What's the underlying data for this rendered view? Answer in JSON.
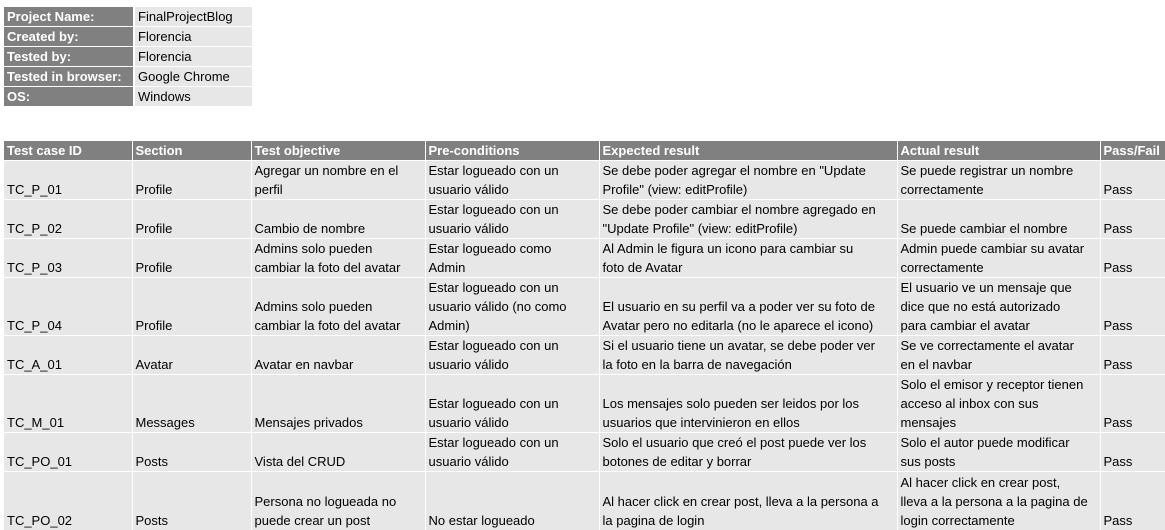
{
  "project_info": [
    {
      "key": "Project Name:",
      "value": "FinalProjectBlog"
    },
    {
      "key": "Created by:",
      "value": "Florencia"
    },
    {
      "key": "Tested by:",
      "value": "Florencia"
    },
    {
      "key": "Tested in browser:",
      "value": "Google Chrome"
    },
    {
      "key": "OS:",
      "value": "Windows"
    }
  ],
  "table": {
    "headers": [
      "Test case ID",
      "Section",
      "Test objective",
      "Pre-conditions",
      "Expected result",
      "Actual result",
      "Pass/Fail"
    ],
    "rows": [
      [
        "TC_P_01",
        "Profile",
        "Agregar un nombre en el\nperfil",
        "Estar logueado con un\nusuario válido",
        "Se debe poder agregar el nombre en \"Update\nProfile\" (view: editProfile)",
        "Se puede registrar un nombre\ncorrectamente",
        "Pass"
      ],
      [
        "TC_P_02",
        "Profile",
        "Cambio de nombre",
        "Estar logueado con un\nusuario válido",
        "Se debe poder cambiar el nombre agregado en\n\"Update Profile\" (view: editProfile)",
        "Se puede cambiar el nombre",
        "Pass"
      ],
      [
        "TC_P_03",
        "Profile",
        "Admins solo pueden\ncambiar la foto del avatar",
        "Estar logueado como\nAdmin",
        "Al Admin le figura un icono para cambiar su\nfoto de Avatar",
        "Admin puede cambiar su avatar\ncorrectamente",
        "Pass"
      ],
      [
        "TC_P_04",
        "Profile",
        "Admins solo pueden\ncambiar la foto del avatar",
        "Estar logueado con un\nusuario válido (no como\nAdmin)",
        "El usuario en su perfil va a poder ver su foto de\nAvatar pero no editarla (no le aparece el icono)",
        "El usuario ve un mensaje que\ndice que no está autorizado\npara cambiar el avatar",
        "Pass"
      ],
      [
        "TC_A_01",
        "Avatar",
        "Avatar en navbar",
        "Estar logueado con un\nusuario válido",
        "Si el usuario tiene un avatar, se debe poder ver\nla foto en la barra de navegación",
        "Se ve correctamente el avatar\nen el navbar",
        "Pass"
      ],
      [
        "TC_M_01",
        "Messages",
        "Mensajes privados",
        "Estar logueado con un\nusuario válido",
        "Los mensajes solo pueden ser leidos por los\nusuarios que intervinieron en ellos",
        "Solo el emisor y receptor tienen\nacceso al inbox con sus\nmensajes",
        "Pass"
      ],
      [
        "TC_PO_01",
        "Posts",
        "Vista del CRUD",
        "Estar logueado con un\nusuario válido",
        "Solo el usuario que creó el post puede ver los\nbotones de editar y borrar",
        "Solo el autor puede modificar\nsus posts",
        "Pass"
      ],
      [
        "TC_PO_02",
        "Posts",
        "Persona no logueada no\npuede crear un post",
        "No estar logueado",
        "Al hacer click en crear post, lleva a la persona a\nla pagina de login",
        "Al hacer click en crear post,\nlleva a la persona a la pagina de\nlogin correctamente",
        "Pass"
      ]
    ]
  }
}
